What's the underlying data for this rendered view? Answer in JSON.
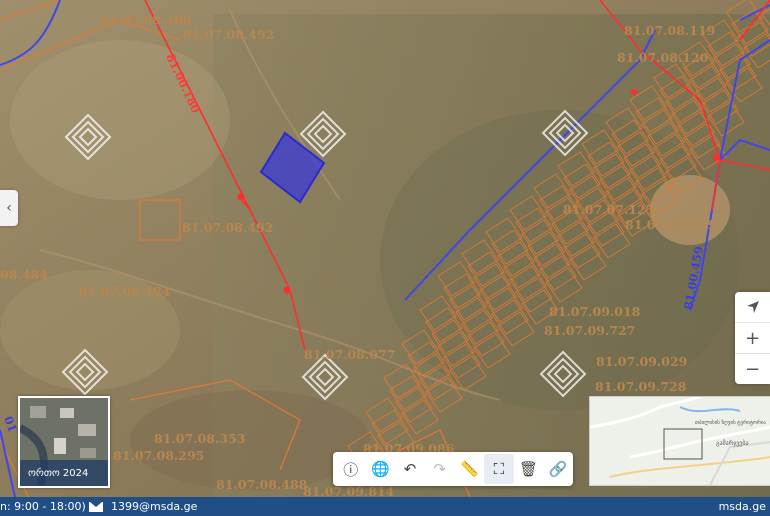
{
  "map": {
    "parcel_labels": [
      "81.07.08.288",
      "81.07.08.492",
      "81.07.08.119",
      "81.07.08.120",
      "81.07.08.492",
      "81.07.07.125",
      "81.07.07.119",
      "08.484",
      "81.07.08.484",
      "81.07.09.018",
      "81.07.09.727",
      "81.07.08.077",
      "81.07.09.029",
      "81.07.09.728",
      "81.07.08.353",
      "81.07.08.295",
      "81.07.09.086",
      "81.07.08.488",
      "81.07.09.814"
    ],
    "road_labels": [
      "81.00.180",
      "81.00.459",
      "01"
    ],
    "colors": {
      "parcel_line": "#e07a35",
      "parcel_label": "#b8864f",
      "road_line": "#ff2d2d",
      "boundary_line": "#4046e8",
      "selection_fill": "#3a3ad8",
      "footer_bg": "#1f4f86"
    }
  },
  "side_toggle": {
    "icon": "chevron-left-icon",
    "glyph": "‹"
  },
  "zoom_controls": {
    "locate_icon": "navigation-arrow-icon",
    "zoom_in": "+",
    "zoom_out": "−"
  },
  "basemap": {
    "caption": "ორთო 2024"
  },
  "overview_map": {
    "label": "თბილისის ზღვის ტერიტორია",
    "label2": "გამარჯვება"
  },
  "toolbar": {
    "tools": [
      {
        "name": "info-icon",
        "glyph": "ⓘ",
        "state": "normal"
      },
      {
        "name": "globe-icon",
        "glyph": "🌐",
        "state": "normal"
      },
      {
        "name": "undo-icon",
        "glyph": "↶",
        "state": "normal"
      },
      {
        "name": "redo-icon",
        "glyph": "↷",
        "state": "disabled"
      },
      {
        "name": "ruler-icon",
        "glyph": "📏",
        "state": "normal"
      },
      {
        "name": "fullscreen-icon",
        "glyph": "⛶",
        "state": "active"
      },
      {
        "name": "trash-icon",
        "glyph": "🗑",
        "state": "normal"
      },
      {
        "name": "link-icon",
        "glyph": "🔗",
        "state": "normal"
      }
    ]
  },
  "footer": {
    "hours": "n: 9:00 - 18:00)",
    "email": "1399@msda.ge",
    "site": "msda.ge"
  }
}
